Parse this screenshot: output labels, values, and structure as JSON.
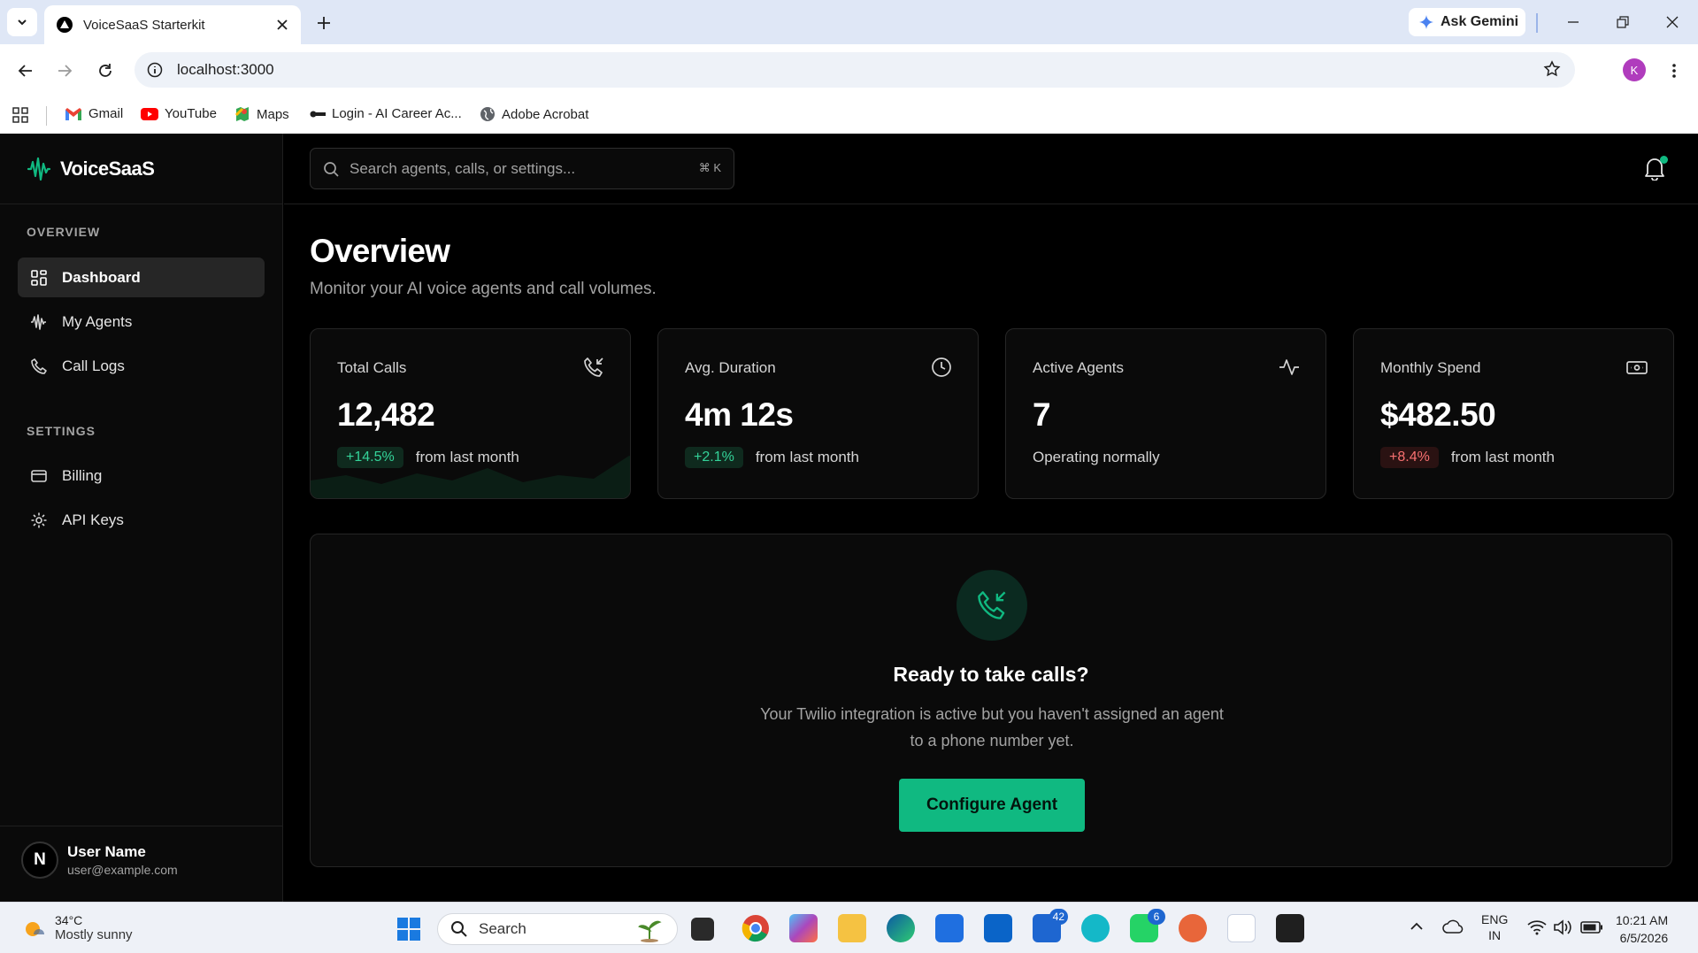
{
  "browser": {
    "tab_title": "VoiceSaaS Starterkit",
    "url": "localhost:3000",
    "gemini_label": "Ask Gemini",
    "profile_initial": "K",
    "bookmarks": [
      "Gmail",
      "YouTube",
      "Maps",
      "Login - AI Career Ac...",
      "Adobe Acrobat"
    ]
  },
  "app": {
    "brand": "VoiceSaaS",
    "accent_color": "#10b981",
    "search_placeholder": "Search agents, calls, or settings...",
    "search_shortcut": "⌘ K",
    "sidebar": {
      "overview_label": "OVERVIEW",
      "settings_label": "SETTINGS",
      "items": [
        {
          "label": "Dashboard",
          "icon": "grid-icon",
          "active": true
        },
        {
          "label": "My Agents",
          "icon": "waveform-icon"
        },
        {
          "label": "Call Logs",
          "icon": "phone-icon"
        },
        {
          "label": "Billing",
          "icon": "credit-card-icon"
        },
        {
          "label": "API Keys",
          "icon": "gear-icon"
        }
      ],
      "user": {
        "initial": "N",
        "name": "User Name",
        "email": "user@example.com"
      }
    },
    "page": {
      "title": "Overview",
      "subtitle": "Monitor your AI voice agents and call volumes."
    },
    "stats": [
      {
        "label": "Total Calls",
        "value": "12,482",
        "delta": "+14.5%",
        "trend": "up",
        "suffix": "from last month",
        "icon": "phone-incoming-icon"
      },
      {
        "label": "Avg. Duration",
        "value": "4m 12s",
        "delta": "+2.1%",
        "trend": "up",
        "suffix": "from last month",
        "icon": "clock-icon"
      },
      {
        "label": "Active Agents",
        "value": "7",
        "note": "Operating normally",
        "icon": "activity-icon"
      },
      {
        "label": "Monthly Spend",
        "value": "$482.50",
        "delta": "+8.4%",
        "trend": "down",
        "suffix": "from last month",
        "icon": "banknote-icon"
      }
    ],
    "empty_state": {
      "title": "Ready to take calls?",
      "text": "Your Twilio integration is active but you haven't assigned an agent to a phone number yet.",
      "button": "Configure Agent"
    }
  },
  "taskbar": {
    "temperature": "34°C",
    "condition": "Mostly sunny",
    "search_label": "Search",
    "badge_outlook": "42",
    "badge_whatsapp": "6",
    "lang_1": "ENG",
    "lang_2": "IN",
    "time": "10:21 AM",
    "date": "6/5/2026"
  }
}
